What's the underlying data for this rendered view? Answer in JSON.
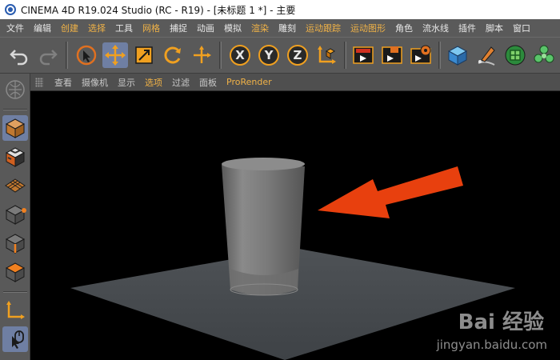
{
  "window": {
    "title": "CINEMA 4D R19.024 Studio (RC - R19) - [未标题 1 *] - 主要"
  },
  "menubar": {
    "items": [
      {
        "label": "文件",
        "accent": false
      },
      {
        "label": "编辑",
        "accent": false
      },
      {
        "label": "创建",
        "accent": true
      },
      {
        "label": "选择",
        "accent": true
      },
      {
        "label": "工具",
        "accent": false
      },
      {
        "label": "网格",
        "accent": true
      },
      {
        "label": "捕捉",
        "accent": false
      },
      {
        "label": "动画",
        "accent": false
      },
      {
        "label": "模拟",
        "accent": false
      },
      {
        "label": "渲染",
        "accent": true
      },
      {
        "label": "雕刻",
        "accent": false
      },
      {
        "label": "运动跟踪",
        "accent": true
      },
      {
        "label": "运动图形",
        "accent": true
      },
      {
        "label": "角色",
        "accent": false
      },
      {
        "label": "流水线",
        "accent": false
      },
      {
        "label": "插件",
        "accent": false
      },
      {
        "label": "脚本",
        "accent": false
      },
      {
        "label": "窗口",
        "accent": false
      }
    ]
  },
  "toolbar": {
    "tools": [
      {
        "name": "undo-icon",
        "active": false
      },
      {
        "name": "redo-icon",
        "active": false
      },
      {
        "name": "live-selection-icon",
        "active": false
      },
      {
        "name": "move-icon",
        "active": true
      },
      {
        "name": "scale-icon",
        "active": false
      },
      {
        "name": "rotate-icon",
        "active": false
      },
      {
        "name": "recent-tool-icon",
        "active": false
      },
      {
        "name": "x-axis-lock-icon",
        "active": false
      },
      {
        "name": "y-axis-lock-icon",
        "active": false
      },
      {
        "name": "z-axis-lock-icon",
        "active": false
      },
      {
        "name": "coordinate-system-icon",
        "active": false
      },
      {
        "name": "render-view-icon",
        "active": false
      },
      {
        "name": "render-to-picture-viewer-icon",
        "active": false
      },
      {
        "name": "render-settings-icon",
        "active": false
      },
      {
        "name": "cube-object-icon",
        "active": false
      },
      {
        "name": "pen-spline-icon",
        "active": false
      },
      {
        "name": "subdivision-surface-icon",
        "active": false
      },
      {
        "name": "cloner-icon",
        "active": false
      }
    ]
  },
  "left_panel": {
    "tools": [
      {
        "name": "make-editable-icon",
        "active": false
      },
      {
        "name": "model-mode-icon",
        "active": true
      },
      {
        "name": "texture-mode-icon",
        "active": false
      },
      {
        "name": "workplane-mode-icon",
        "active": false
      },
      {
        "name": "points-mode-icon",
        "active": false
      },
      {
        "name": "edges-mode-icon",
        "active": false
      },
      {
        "name": "polygons-mode-icon",
        "active": false
      },
      {
        "name": "axis-mode-icon",
        "active": false
      },
      {
        "name": "tweak-mode-icon",
        "active": false
      }
    ]
  },
  "viewport_header": {
    "menus": [
      {
        "label": "查看",
        "accent": false
      },
      {
        "label": "摄像机",
        "accent": false
      },
      {
        "label": "显示",
        "accent": false
      },
      {
        "label": "选项",
        "accent": true
      },
      {
        "label": "过滤",
        "accent": false
      },
      {
        "label": "面板",
        "accent": false
      },
      {
        "label": "ProRender",
        "accent": true
      }
    ]
  },
  "scene": {
    "background": "#000000",
    "floor_color": "#4a4e52",
    "cylinder_color": "#7d7d7d",
    "arrow_color": "#e8400e"
  },
  "watermark": {
    "logo": "Bai 经验",
    "url": "jingyan.baidu.com"
  },
  "colors": {
    "accent": "#f0b247",
    "active_tool": "#6f7fa3",
    "panel_bg": "#595959"
  }
}
